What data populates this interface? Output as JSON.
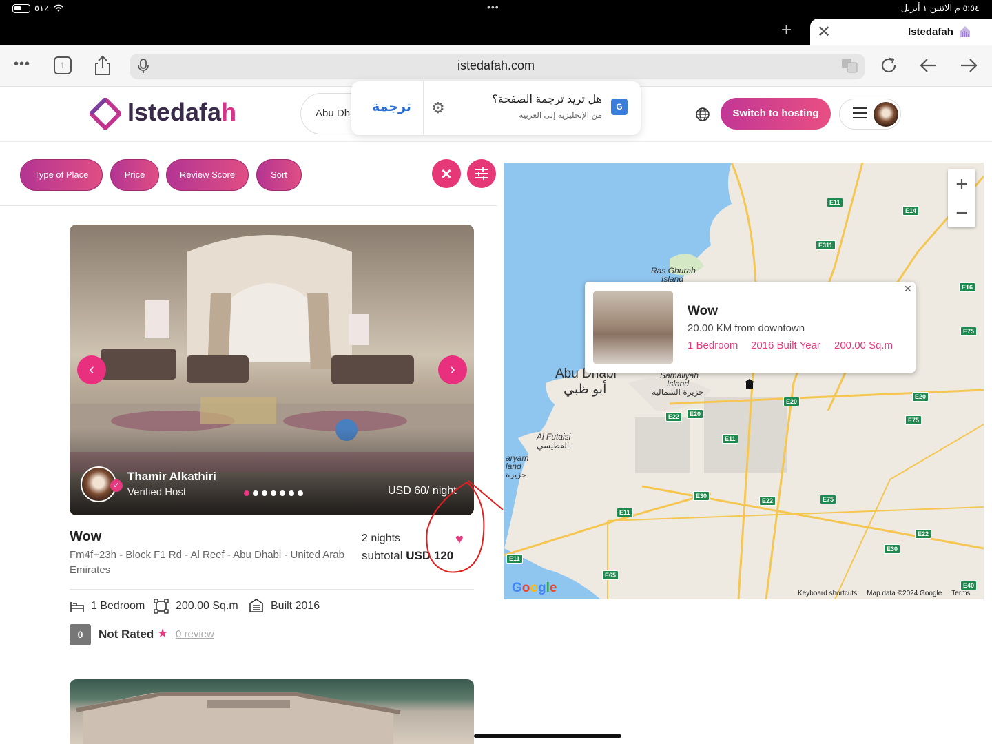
{
  "status_bar": {
    "battery": "٥١٪",
    "time_date": "٥:٥٤ م  الاثنين ١ أبريل",
    "dots": "•••"
  },
  "browser": {
    "tab_title": "Istedafah",
    "url": "istedafah.com"
  },
  "header": {
    "logo": "Istedafa",
    "logo_accent": "h",
    "search_text": "Abu Dh",
    "hosting_button": "Switch to hosting"
  },
  "translate_popup": {
    "button": "ترجمة",
    "question": "هل تريد ترجمة الصفحة؟",
    "subtitle": "من الإنجليزية إلى العربية"
  },
  "filters": {
    "type_of_place": "Type of Place",
    "price": "Price",
    "review_score": "Review Score",
    "sort": "Sort"
  },
  "listing": {
    "host_name": "Thamir Alkathiri",
    "host_sub": "Verified Host",
    "price_night": "USD 60/ night",
    "title": "Wow",
    "address": "Fm4f+23h - Block F1 Rd - Al Reef - Abu Dhabi - United Arab Emirates",
    "nights": "2 nights",
    "subtotal_label": "subtotal ",
    "subtotal_value": "USD 120",
    "bedrooms": "1 Bedroom",
    "area": "200.00 Sq.m",
    "built": "Built 2016",
    "rating_score": "0",
    "rating_label": "Not Rated",
    "reviews": "0 review",
    "image_count": 7,
    "active_image": 1
  },
  "map": {
    "zoom_in": "+",
    "zoom_out": "−",
    "popup": {
      "title": "Wow",
      "distance": "20.00 KM from downtown",
      "bedrooms": "1 Bedroom",
      "built": "2016 Built Year",
      "area": "200.00 Sq.m"
    },
    "labels": {
      "abu_dhabi": "Abu Dhabi",
      "abu_dhabi_ar": "أبو ظبي",
      "ras_ghurab": "Ras Ghurab",
      "island": "Island",
      "samaliyah": "Samaliyah",
      "samaliyah_ar": "جزيرة الشمالية",
      "al_futaisi": "Al Futaisi",
      "al_futaisi_ar": "الفطيسي",
      "aryam": "aryam",
      "aryam_land": "land",
      "aryam_ar": "جزيرة"
    },
    "roads": [
      "E11",
      "E14",
      "E311",
      "E16",
      "E75",
      "E20",
      "E22",
      "E20",
      "E11",
      "E75",
      "E20",
      "E30",
      "E22",
      "E75",
      "E22",
      "E30",
      "E11",
      "E11",
      "E65",
      "E40"
    ],
    "google": "Google",
    "footer": [
      "Keyboard shortcuts",
      "Map data ©2024 Google",
      "Terms"
    ]
  }
}
